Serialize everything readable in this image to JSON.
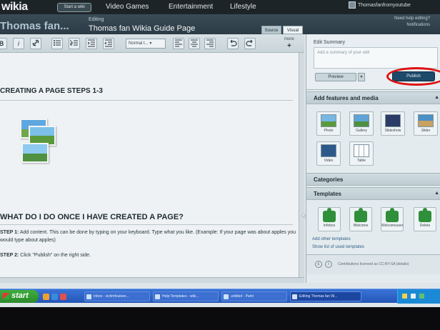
{
  "topnav": {
    "logo": "wikia",
    "start_wiki": "Start a wiki",
    "links": [
      "Video Games",
      "Entertainment",
      "Lifestyle"
    ],
    "username": "Thomasfanfromyoutube"
  },
  "header": {
    "wiki_name": "Thomas fan...",
    "editing_label": "Editing",
    "page_title": "Thomas fan Wikia Guide Page",
    "tabs": [
      "Source",
      "Visual"
    ],
    "help_links": [
      "Need help editing?",
      "Notifications"
    ]
  },
  "toolbar": {
    "buttons": [
      "B",
      "I",
      "link",
      "ul",
      "ol",
      "indent",
      "outdent"
    ],
    "format_select": "Normal t...",
    "align": [
      "left",
      "center",
      "right"
    ],
    "undo": "undo",
    "redo": "redo",
    "more": "more"
  },
  "editor": {
    "heading1": "CREATING A PAGE STEPS 1-3",
    "heading2": "WHAT DO I DO ONCE I HAVE CREATED A PAGE?",
    "step1_label": "STEP 1:",
    "step1_text": "Add content. This can be done by typing on your keyboard. Type what you like. (Example: If your page was about apples you would type about apples)",
    "step2_label": "STEP 2:",
    "step2_text": "Click \"Publish\" on the right side."
  },
  "rail": {
    "summary_label": "Edit Summary",
    "summary_placeholder": "Add a summary of your edit",
    "preview_label": "Preview",
    "publish_label": "Publish",
    "features_title": "Add features and media",
    "media_tiles": [
      "Photo",
      "Gallery",
      "Slideshow",
      "Slider",
      "Video",
      "Table"
    ],
    "categories_title": "Categories",
    "templates_title": "Templates",
    "template_tiles": [
      "Infobox",
      "Welcome",
      "Welcomeuser",
      "Delete"
    ],
    "add_templates_link": "Add other templates",
    "show_templates_link": "Show list of used templates",
    "license_text": "Contributions licensed as CC-BY-SA (details)"
  },
  "taskbar": {
    "start": "start",
    "tasks": [
      "Inbox - victimfoulsee...",
      "Help:Templates - wiki...",
      "untitled - Paint",
      "Editing Thomas fan W..."
    ]
  },
  "colors": {
    "publish": "#1e4a6a",
    "highlight_ring": "#e01010",
    "taskbar": "#2456b8"
  }
}
